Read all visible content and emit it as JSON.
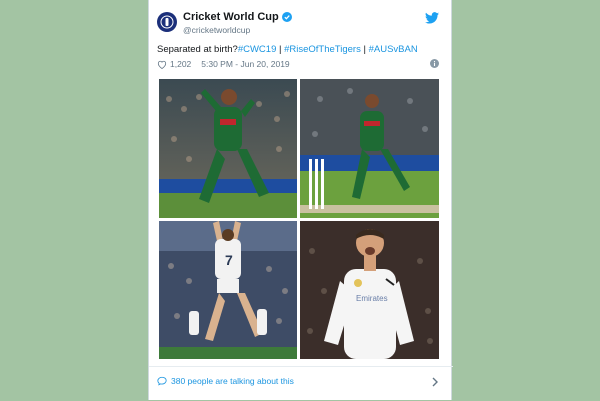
{
  "tweet": {
    "author_name": "Cricket World Cup",
    "author_handle": "@cricketworldcup",
    "text_prefix": "Separated at birth?",
    "hashtags": [
      "#CWC19",
      "#RiseOfTheTigers",
      "#AUSvBAN"
    ],
    "separator": " | ",
    "likes": "1,202",
    "timestamp": "5:30 PM - Jun 20, 2019",
    "footer_text": "380 people are talking about this"
  },
  "colors": {
    "accent": "#1b95e0",
    "page_bg": "#a3c4a3"
  },
  "icons": [
    "cwc-logo-icon",
    "verified-icon",
    "twitter-bird-icon",
    "heart-icon",
    "info-icon",
    "comment-icon",
    "chevron-right-icon"
  ]
}
